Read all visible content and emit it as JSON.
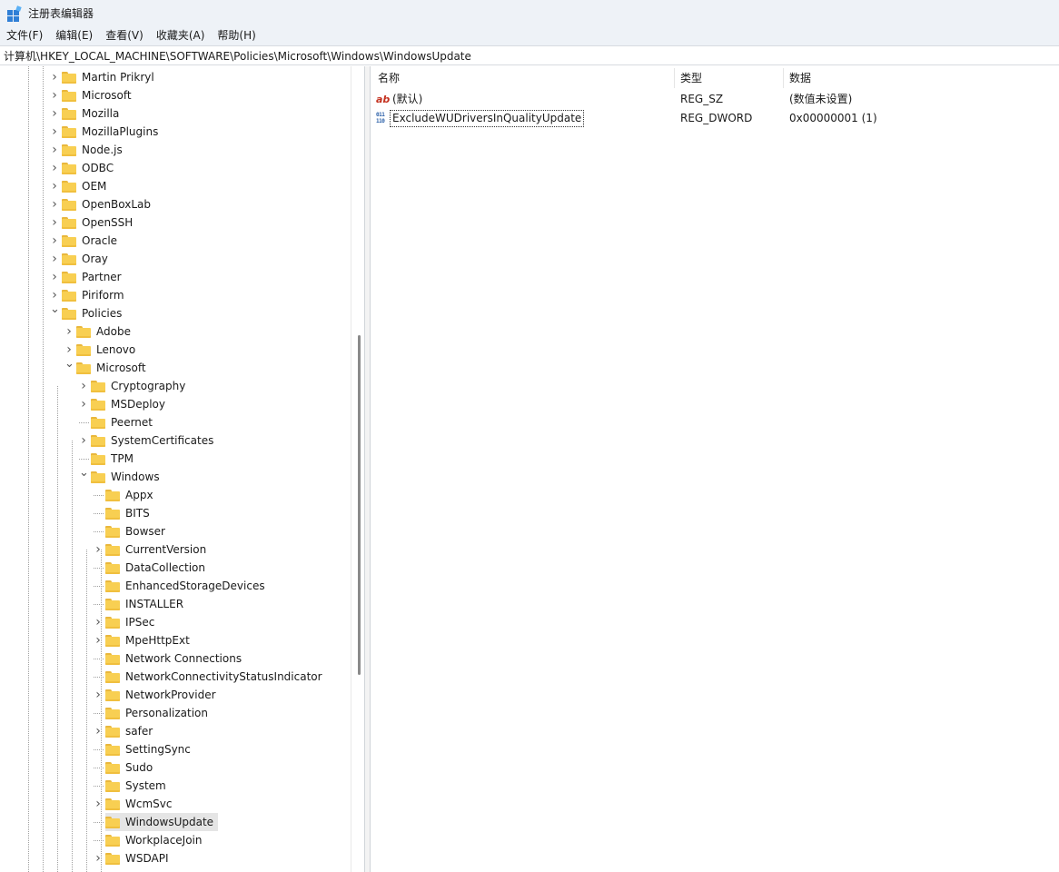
{
  "window": {
    "title": "注册表编辑器"
  },
  "menu": {
    "items": [
      "文件(F)",
      "编辑(E)",
      "查看(V)",
      "收藏夹(A)",
      "帮助(H)"
    ]
  },
  "address": "计算机\\HKEY_LOCAL_MACHINE\\SOFTWARE\\Policies\\Microsoft\\Windows\\WindowsUpdate",
  "tree": [
    {
      "label": "Martin Prikryl",
      "depth": 0,
      "expander": "collapsed"
    },
    {
      "label": "Microsoft",
      "depth": 0,
      "expander": "collapsed"
    },
    {
      "label": "Mozilla",
      "depth": 0,
      "expander": "collapsed"
    },
    {
      "label": "MozillaPlugins",
      "depth": 0,
      "expander": "collapsed"
    },
    {
      "label": "Node.js",
      "depth": 0,
      "expander": "collapsed"
    },
    {
      "label": "ODBC",
      "depth": 0,
      "expander": "collapsed"
    },
    {
      "label": "OEM",
      "depth": 0,
      "expander": "collapsed"
    },
    {
      "label": "OpenBoxLab",
      "depth": 0,
      "expander": "collapsed"
    },
    {
      "label": "OpenSSH",
      "depth": 0,
      "expander": "collapsed"
    },
    {
      "label": "Oracle",
      "depth": 0,
      "expander": "collapsed"
    },
    {
      "label": "Oray",
      "depth": 0,
      "expander": "collapsed"
    },
    {
      "label": "Partner",
      "depth": 0,
      "expander": "collapsed"
    },
    {
      "label": "Piriform",
      "depth": 0,
      "expander": "collapsed"
    },
    {
      "label": "Policies",
      "depth": 0,
      "expander": "expanded"
    },
    {
      "label": "Adobe",
      "depth": 1,
      "expander": "collapsed"
    },
    {
      "label": "Lenovo",
      "depth": 1,
      "expander": "collapsed"
    },
    {
      "label": "Microsoft",
      "depth": 1,
      "expander": "expanded"
    },
    {
      "label": "Cryptography",
      "depth": 2,
      "expander": "collapsed"
    },
    {
      "label": "MSDeploy",
      "depth": 2,
      "expander": "collapsed"
    },
    {
      "label": "Peernet",
      "depth": 2,
      "expander": "none"
    },
    {
      "label": "SystemCertificates",
      "depth": 2,
      "expander": "collapsed"
    },
    {
      "label": "TPM",
      "depth": 2,
      "expander": "none"
    },
    {
      "label": "Windows",
      "depth": 2,
      "expander": "expanded"
    },
    {
      "label": "Appx",
      "depth": 3,
      "expander": "none"
    },
    {
      "label": "BITS",
      "depth": 3,
      "expander": "none"
    },
    {
      "label": "Bowser",
      "depth": 3,
      "expander": "none"
    },
    {
      "label": "CurrentVersion",
      "depth": 3,
      "expander": "collapsed"
    },
    {
      "label": "DataCollection",
      "depth": 3,
      "expander": "none"
    },
    {
      "label": "EnhancedStorageDevices",
      "depth": 3,
      "expander": "none"
    },
    {
      "label": "INSTALLER",
      "depth": 3,
      "expander": "none"
    },
    {
      "label": "IPSec",
      "depth": 3,
      "expander": "collapsed"
    },
    {
      "label": "MpeHttpExt",
      "depth": 3,
      "expander": "collapsed"
    },
    {
      "label": "Network Connections",
      "depth": 3,
      "expander": "none"
    },
    {
      "label": "NetworkConnectivityStatusIndicator",
      "depth": 3,
      "expander": "none"
    },
    {
      "label": "NetworkProvider",
      "depth": 3,
      "expander": "collapsed"
    },
    {
      "label": "Personalization",
      "depth": 3,
      "expander": "none"
    },
    {
      "label": "safer",
      "depth": 3,
      "expander": "collapsed"
    },
    {
      "label": "SettingSync",
      "depth": 3,
      "expander": "none"
    },
    {
      "label": "Sudo",
      "depth": 3,
      "expander": "none"
    },
    {
      "label": "System",
      "depth": 3,
      "expander": "none"
    },
    {
      "label": "WcmSvc",
      "depth": 3,
      "expander": "collapsed"
    },
    {
      "label": "WindowsUpdate",
      "depth": 3,
      "expander": "none",
      "selected": true
    },
    {
      "label": "WorkplaceJoin",
      "depth": 3,
      "expander": "none"
    },
    {
      "label": "WSDAPI",
      "depth": 3,
      "expander": "collapsed"
    }
  ],
  "list": {
    "headers": {
      "name": "名称",
      "type": "类型",
      "data": "数据"
    },
    "rows": [
      {
        "icon": "string-value-icon",
        "icon_text": "ab",
        "name": "(默认)",
        "type": "REG_SZ",
        "data": "(数值未设置)"
      },
      {
        "icon": "binary-value-icon",
        "icon_text": "011 110",
        "name": "ExcludeWUDriversInQualityUpdate",
        "type": "REG_DWORD",
        "data": "0x00000001 (1)",
        "focused": true
      }
    ]
  }
}
